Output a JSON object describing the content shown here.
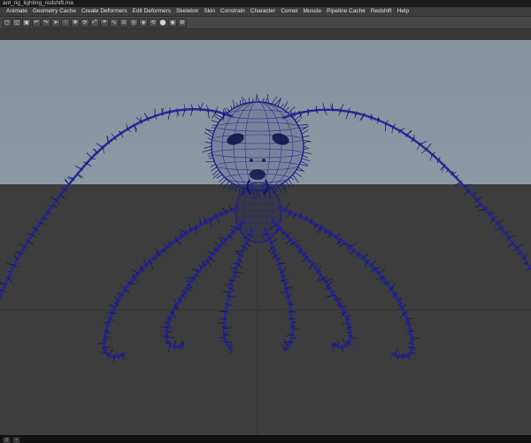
{
  "window": {
    "title": "ant_rig_lighting_redshift.ma"
  },
  "menu_bar": {
    "items": [
      "Animate",
      "Geometry Cache",
      "Create Deformers",
      "Edit Deformers",
      "Skeleton",
      "Skin",
      "Constrain",
      "Character",
      "Comet",
      "Muscle",
      "Pipeline Cache",
      "Redshift",
      "Help"
    ]
  },
  "toolbar": {
    "icons": [
      {
        "name": "new-scene-icon",
        "glyph": "▢"
      },
      {
        "name": "open-scene-icon",
        "glyph": "◱"
      },
      {
        "name": "save-scene-icon",
        "glyph": "▣"
      },
      {
        "name": "undo-icon",
        "glyph": "↶"
      },
      {
        "name": "redo-icon",
        "glyph": "↷"
      },
      {
        "name": "select-tool-icon",
        "glyph": "➤"
      },
      {
        "name": "lasso-tool-icon",
        "glyph": "◌"
      },
      {
        "name": "move-tool-icon",
        "glyph": "✥"
      },
      {
        "name": "rotate-tool-icon",
        "glyph": "⟳"
      },
      {
        "name": "scale-tool-icon",
        "glyph": "⤢"
      },
      {
        "name": "snap-grid-icon",
        "glyph": "⌗"
      },
      {
        "name": "snap-curve-icon",
        "glyph": "∿"
      },
      {
        "name": "snap-point-icon",
        "glyph": "⊙"
      },
      {
        "name": "snap-view-icon",
        "glyph": "◎"
      },
      {
        "name": "make-live-icon",
        "glyph": "◈"
      },
      {
        "name": "history-icon",
        "glyph": "⟲"
      },
      {
        "name": "render-icon",
        "glyph": "⬤"
      },
      {
        "name": "ipr-render-icon",
        "glyph": "◉"
      },
      {
        "name": "render-settings-icon",
        "glyph": "⚙"
      }
    ]
  },
  "viewport": {
    "sky_top": "#85939f",
    "sky_bottom": "#8b99a5",
    "ground": "#3d3d3d",
    "wire_color": "#1f1f8f",
    "wire_dark": "#14146a",
    "wire_light": "#4a4ab8",
    "grid_line": "#333333",
    "axis_line": "#2f2f44"
  },
  "statusbar": {
    "icons": [
      {
        "name": "script-editor-icon",
        "glyph": "≡"
      },
      {
        "name": "command-line-icon",
        "glyph": "›"
      }
    ]
  }
}
